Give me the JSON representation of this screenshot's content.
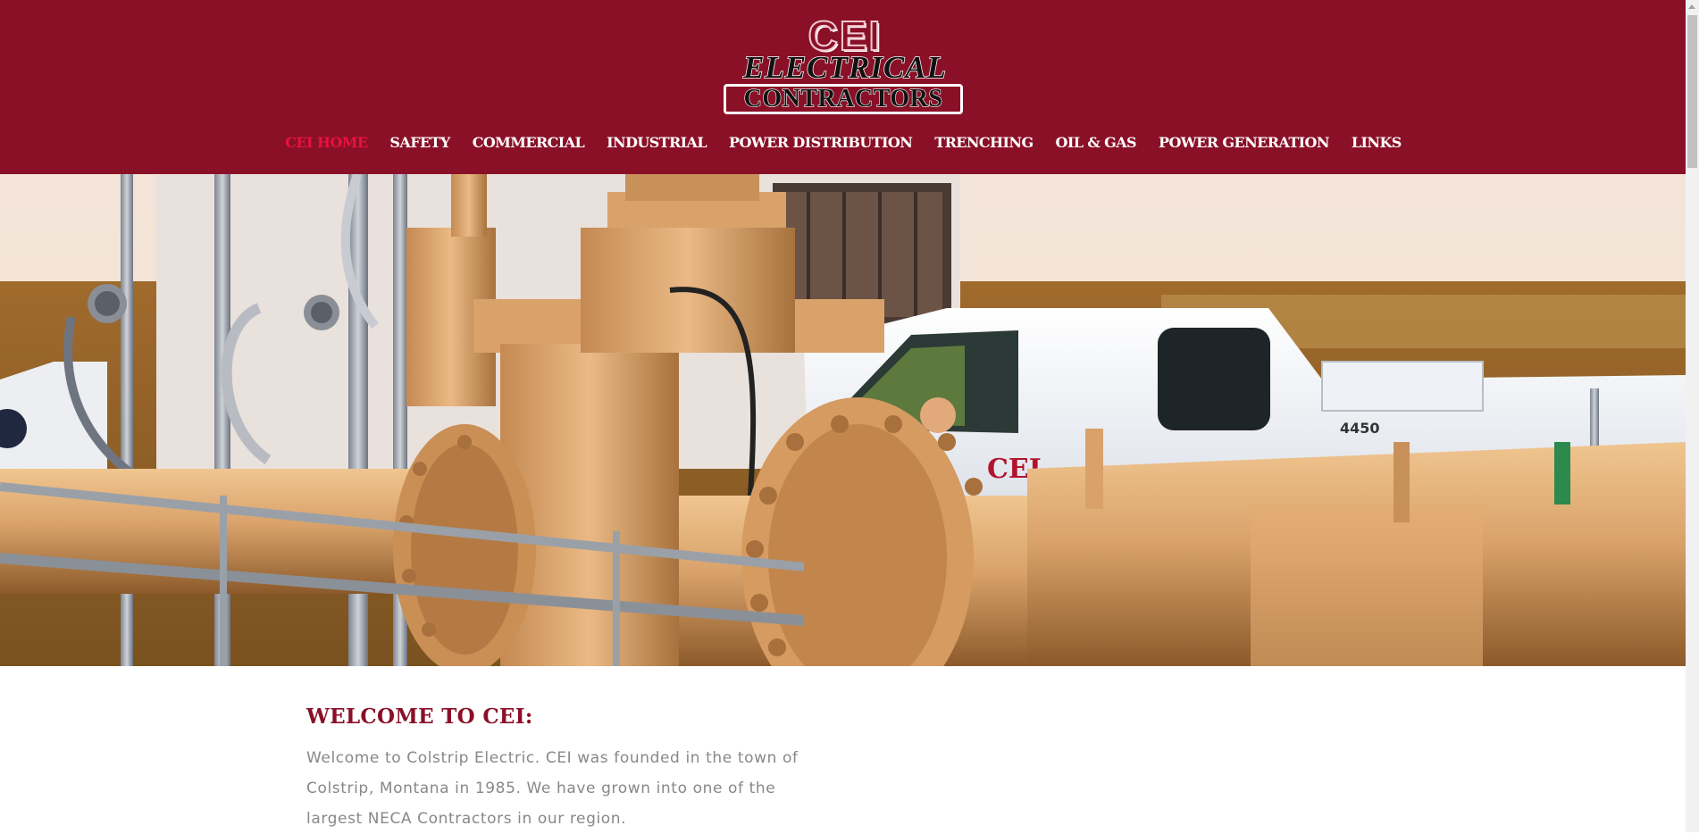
{
  "logo": {
    "line1": "CEI",
    "line2": "ELECTRICAL",
    "line3": "CONTRACTORS"
  },
  "nav": [
    {
      "label": "CEI HOME",
      "active": true
    },
    {
      "label": "SAFETY"
    },
    {
      "label": "COMMERCIAL"
    },
    {
      "label": "INDUSTRIAL"
    },
    {
      "label": "POWER DISTRIBUTION"
    },
    {
      "label": "TRENCHING"
    },
    {
      "label": "OIL & GAS"
    },
    {
      "label": "POWER GENERATION"
    },
    {
      "label": "LINKS"
    }
  ],
  "hero": {
    "truck_text": "CEI",
    "truck_number": "4450"
  },
  "welcome": {
    "title": "WELCOME TO CEI:",
    "text": "Welcome to Colstrip Electric. CEI was founded in the town of Colstrip, Montana in 1985. We have grown into one of the largest NECA Contractors in our region."
  },
  "colors": {
    "brand": "#8a1027",
    "active_nav": "#e8123f",
    "body_text": "#888888"
  }
}
